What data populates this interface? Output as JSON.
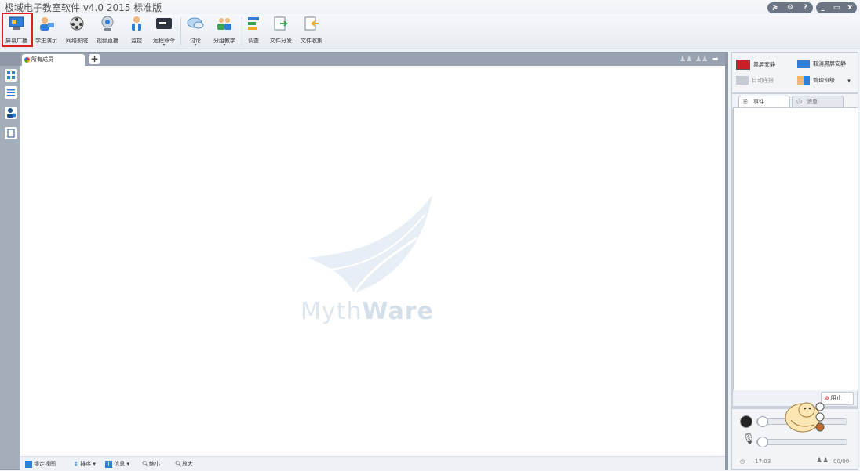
{
  "window": {
    "title": "极域电子教室软件 v4.0 2015 标准版",
    "controls_left": [
      "≽",
      "⚙",
      "?"
    ],
    "controls_right": [
      "_",
      "▭",
      "x"
    ]
  },
  "toolbar": {
    "items": [
      {
        "label": "屏幕广播",
        "icon": "screen-broadcast-icon"
      },
      {
        "label": "学生演示",
        "icon": "student-demo-icon"
      },
      {
        "label": "网络影院",
        "icon": "network-cinema-icon"
      },
      {
        "label": "视频直播",
        "icon": "video-live-icon"
      },
      {
        "label": "监控",
        "icon": "monitor-icon"
      },
      {
        "label": "远程命令",
        "icon": "remote-command-icon",
        "dropdown": "▾"
      },
      {
        "label": "讨论",
        "icon": "discussion-icon",
        "dropdown": "▾"
      },
      {
        "label": "分组教学",
        "icon": "group-teaching-icon",
        "dropdown": "▾"
      },
      {
        "label": "调查",
        "icon": "survey-icon"
      },
      {
        "label": "文件分发",
        "icon": "file-distribute-icon"
      },
      {
        "label": "文件收集",
        "icon": "file-collect-icon"
      }
    ]
  },
  "tabs": {
    "active": "所有成员",
    "add": "+"
  },
  "canvas": {
    "logo_light": "Myth",
    "logo_bold": "Ware"
  },
  "statusbar": {
    "lock_view": "锁定视图",
    "sort": "排序",
    "sort_arrow": "▾",
    "info": "信息",
    "info_arrow": "▾",
    "zoom_out": "缩小",
    "zoom_in": "放大"
  },
  "right": {
    "black_screen": "黑屏安静",
    "cancel_black_screen": "取消黑屏安静",
    "auto_login": "自动连接",
    "manage_class": "管理班级",
    "manage_arrow": "▾",
    "tab_events": "事件",
    "tab_messages": "消息",
    "block": "阻止",
    "time": "17:03",
    "counter": "00/00"
  },
  "colors": {
    "highlight": "#e02020",
    "frame": "#8e98a6",
    "panel": "#c9d0da"
  }
}
